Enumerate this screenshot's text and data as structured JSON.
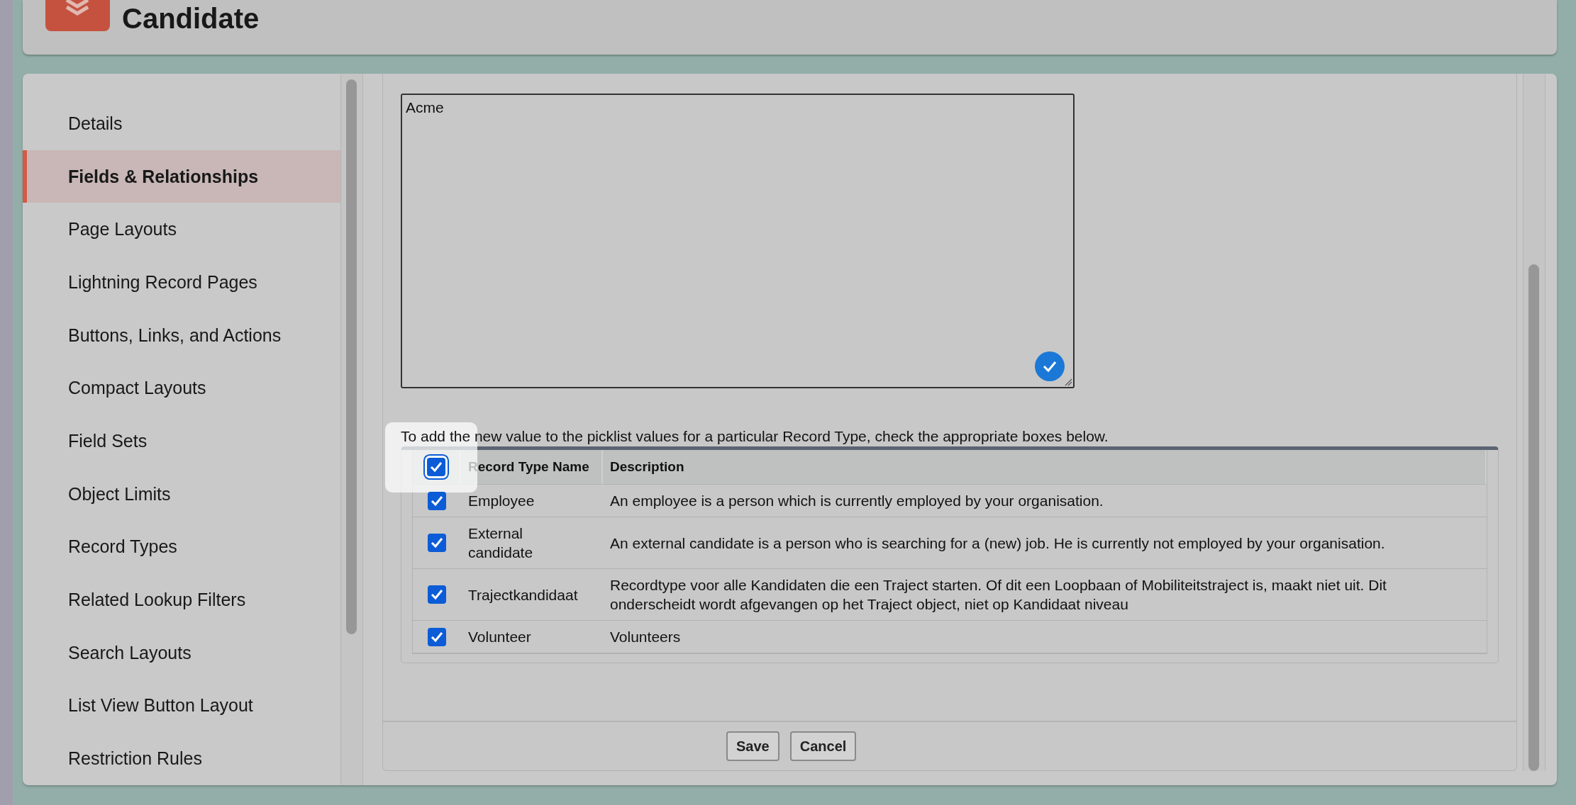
{
  "object": {
    "title": "Candidate"
  },
  "sidebar": {
    "items": [
      {
        "label": "Details",
        "selected": false
      },
      {
        "label": "Fields & Relationships",
        "selected": true
      },
      {
        "label": "Page Layouts",
        "selected": false
      },
      {
        "label": "Lightning Record Pages",
        "selected": false
      },
      {
        "label": "Buttons, Links, and Actions",
        "selected": false
      },
      {
        "label": "Compact Layouts",
        "selected": false
      },
      {
        "label": "Field Sets",
        "selected": false
      },
      {
        "label": "Object Limits",
        "selected": false
      },
      {
        "label": "Record Types",
        "selected": false
      },
      {
        "label": "Related Lookup Filters",
        "selected": false
      },
      {
        "label": "Search Layouts",
        "selected": false
      },
      {
        "label": "List View Button Layout",
        "selected": false
      },
      {
        "label": "Restriction Rules",
        "selected": false
      }
    ]
  },
  "values_field": {
    "value": "Acme",
    "validated": true
  },
  "instructions": "To add the new value to the picklist values for a particular Record Type, check the appropriate boxes below.",
  "record_types": {
    "select_all": {
      "checked": true,
      "focused": true
    },
    "columns": [
      "Record Type Name",
      "Description"
    ],
    "rows": [
      {
        "checked": true,
        "name": "Employee",
        "description": "An employee is a person which is currently employed by your organisation."
      },
      {
        "checked": true,
        "name": "External candidate",
        "description": "An external candidate is a person who is searching for a (new) job. He is currently not employed by your organisation."
      },
      {
        "checked": true,
        "name": "Trajectkandidaat",
        "description": "Recordtype voor alle Kandidaten die een Traject starten. Of dit een Loopbaan of Mobiliteitstraject is, maakt niet uit. Dit onderscheidt wordt afgevangen op het Traject object, niet op Kandidaat niveau"
      },
      {
        "checked": true,
        "name": "Volunteer",
        "description": "Volunteers"
      }
    ]
  },
  "buttons": [
    "Save",
    "Cancel"
  ]
}
